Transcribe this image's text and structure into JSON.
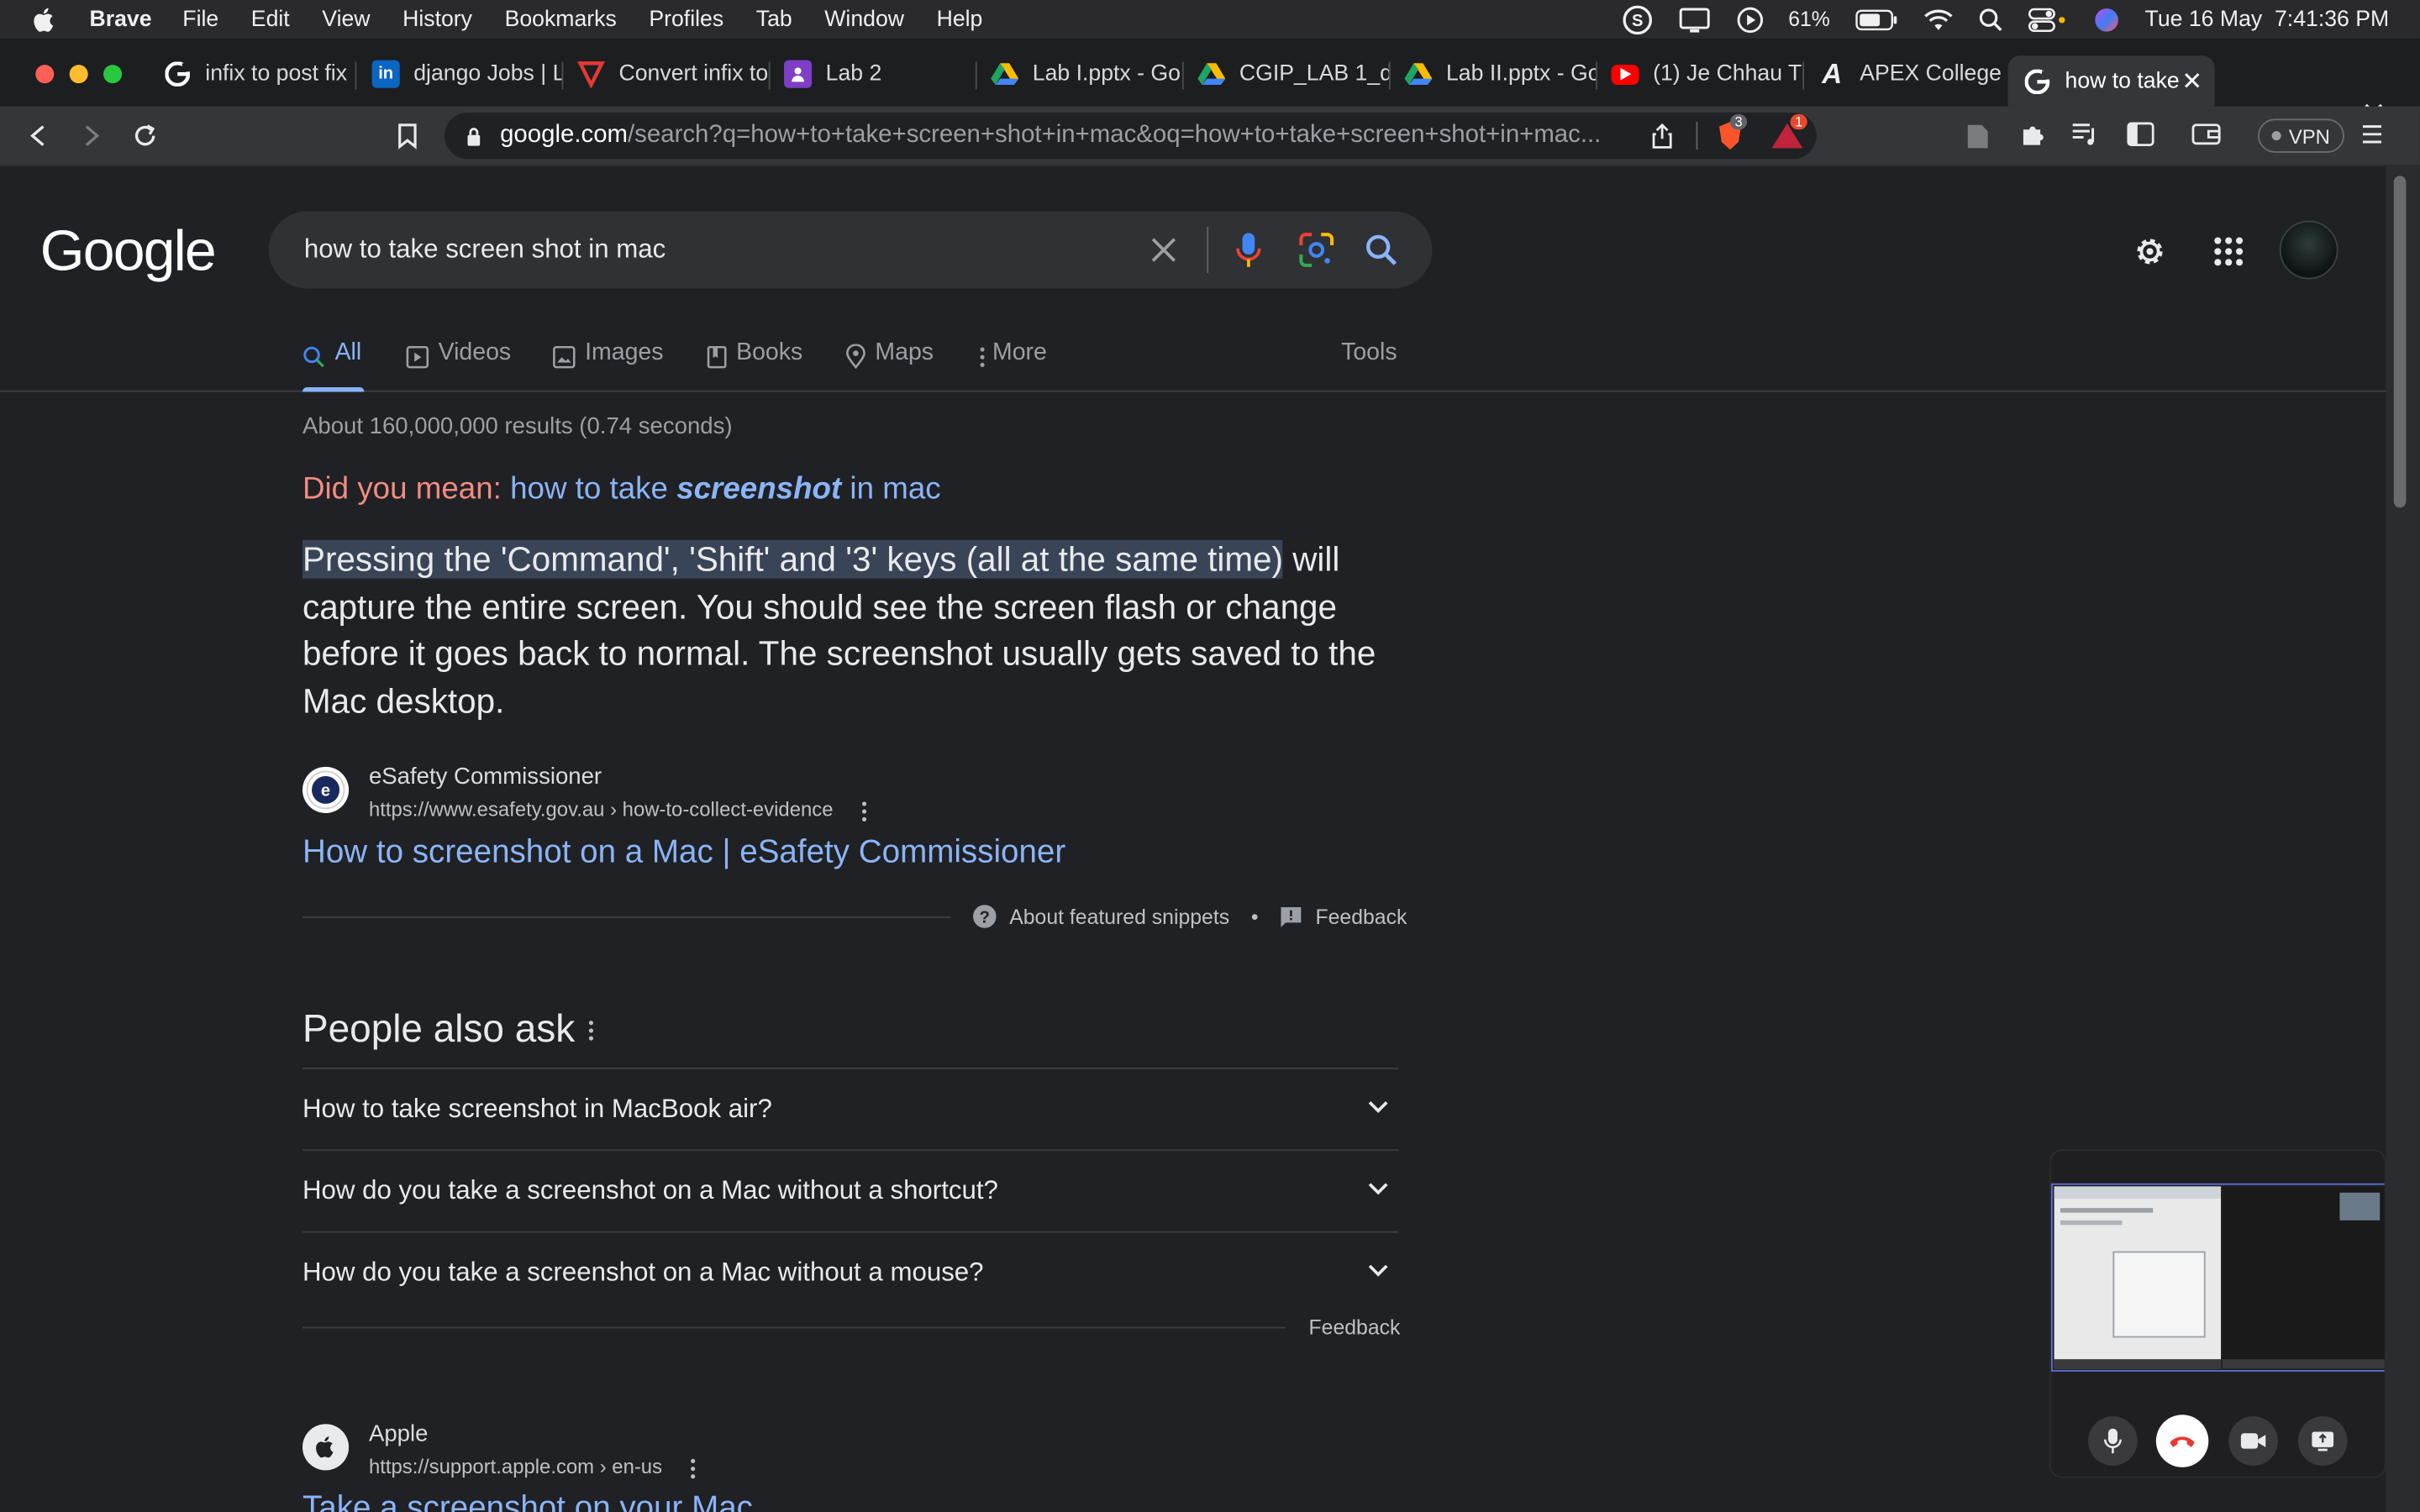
{
  "menubar": {
    "app_name": "Brave",
    "items": [
      "File",
      "Edit",
      "View",
      "History",
      "Bookmarks",
      "Profiles",
      "Tab",
      "Window",
      "Help"
    ],
    "battery": "61%",
    "datetime": "Tue 16 May  7:41:36 PM"
  },
  "tabs": [
    {
      "title": "infix to post fix",
      "favicon": "google-icon"
    },
    {
      "title": "django Jobs | L",
      "favicon": "linkedin-icon"
    },
    {
      "title": "Convert infix to",
      "favicon": "tutorial-icon"
    },
    {
      "title": "Lab 2",
      "favicon": "classroom-icon"
    },
    {
      "title": "Lab I.pptx - Go",
      "favicon": "drive-icon"
    },
    {
      "title": "CGIP_LAB 1_de",
      "favicon": "drive-icon"
    },
    {
      "title": "Lab II.pptx - Go",
      "favicon": "drive-icon"
    },
    {
      "title": "(1) Je Chhau Ti",
      "favicon": "youtube-icon"
    },
    {
      "title": "APEX College",
      "favicon": "apex-icon"
    },
    {
      "title": "how to take",
      "favicon": "google-icon",
      "active": true
    }
  ],
  "toolbar": {
    "url_host": "google.com",
    "url_path": "/search?q=how+to+take+screen+shot+in+mac&oq=how+to+take+screen+shot+in+mac...",
    "brave_shield_count": "3",
    "rewards_count": "1",
    "vpn_label": "VPN"
  },
  "google": {
    "logo": "Google",
    "query": "how to take screen shot in mac",
    "nav_tabs": [
      {
        "label": "All",
        "icon": "search-icon",
        "active": true
      },
      {
        "label": "Videos",
        "icon": "play-icon"
      },
      {
        "label": "Images",
        "icon": "image-icon"
      },
      {
        "label": "Books",
        "icon": "book-icon"
      },
      {
        "label": "Maps",
        "icon": "location-pin-icon"
      },
      {
        "label": "More",
        "icon": "more-vert-icon"
      }
    ],
    "tools_label": "Tools",
    "results_count": "About 160,000,000 results (0.74 seconds)",
    "did_you_mean": {
      "prefix": "Did you mean:",
      "before": "how to take",
      "bold": "screenshot",
      "after": "in mac"
    },
    "snippet": {
      "highlight": "Pressing the 'Command', 'Shift' and '3' keys (all at the same time)",
      "rest": "will capture the entire screen. You should see the screen flash or change before it goes back to normal. The screenshot usually gets saved to the Mac desktop."
    },
    "featured_source": {
      "name": "eSafety Commissioner",
      "url": "https://www.esafety.gov.au › how-to-collect-evidence",
      "title": "How to screenshot on a Mac | eSafety Commissioner"
    },
    "about_snippets": "About featured snippets",
    "feedback": "Feedback",
    "paa": {
      "title": "People also ask",
      "questions": [
        "How to take screenshot in MacBook air?",
        "How do you take a screenshot on a Mac without a shortcut?",
        "How do you take a screenshot on a Mac without a mouse?"
      ],
      "feedback": "Feedback"
    },
    "second_result": {
      "name": "Apple",
      "url": "https://support.apple.com › en-us",
      "title": "Take a screenshot on your Mac"
    }
  },
  "colors": {
    "background": "#202124",
    "link": "#8ab4f8",
    "did_you_mean": "#f28b82",
    "highlight": "#394457"
  }
}
